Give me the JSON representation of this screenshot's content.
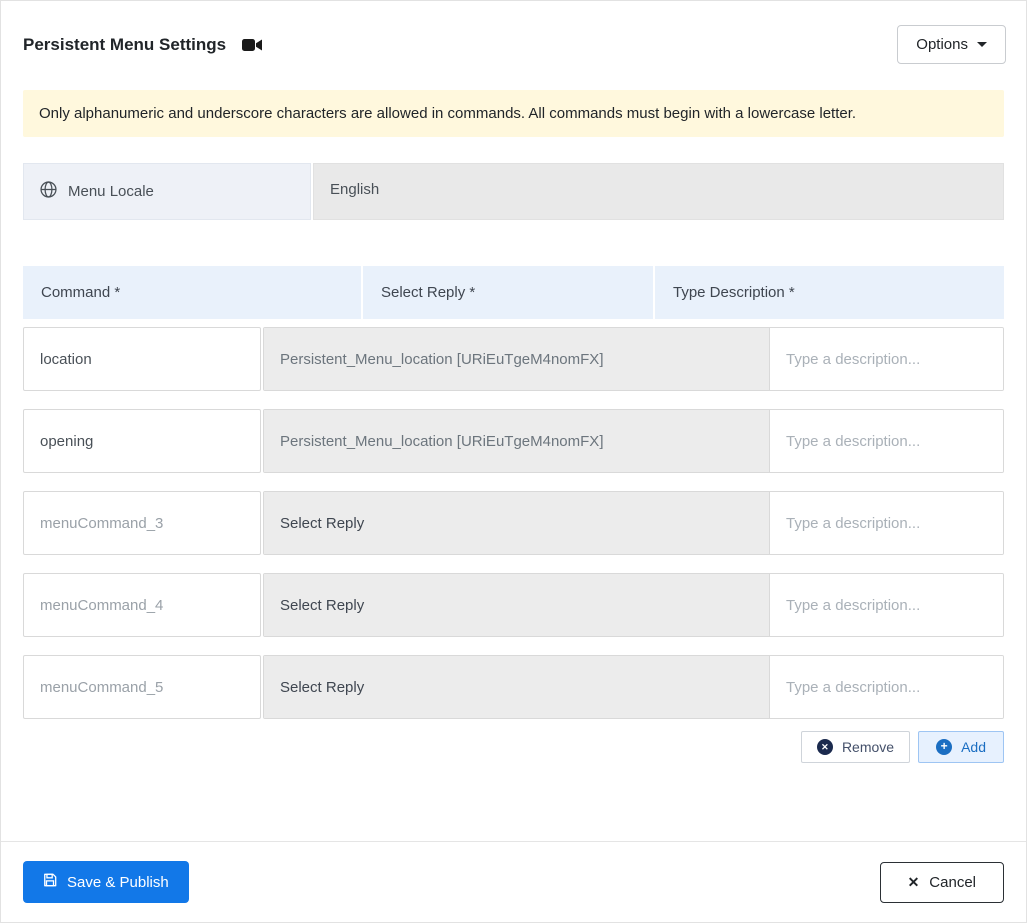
{
  "header": {
    "title": "Persistent Menu Settings",
    "options_label": "Options"
  },
  "alert": {
    "text": "Only alphanumeric and underscore characters are allowed in commands. All commands must begin with a lowercase letter."
  },
  "locale": {
    "label": "Menu Locale",
    "value": "English"
  },
  "table": {
    "headers": [
      "Command *",
      "Select Reply *",
      "Type Description *"
    ]
  },
  "rows": [
    {
      "command_value": "location",
      "reply": "Persistent_Menu_location [URiEuTgeM4nomFX]",
      "description_placeholder": "Type a description..."
    },
    {
      "command_value": "opening",
      "reply": "Persistent_Menu_location [URiEuTgeM4nomFX]",
      "description_placeholder": "Type a description..."
    },
    {
      "command_placeholder": "menuCommand_3",
      "reply": "Select Reply",
      "description_placeholder": "Type a description..."
    },
    {
      "command_placeholder": "menuCommand_4",
      "reply": "Select Reply",
      "description_placeholder": "Type a description..."
    },
    {
      "command_placeholder": "menuCommand_5",
      "reply": "Select Reply",
      "description_placeholder": "Type a description..."
    }
  ],
  "actions": {
    "remove_label": "Remove",
    "add_label": "Add"
  },
  "footer": {
    "save_label": "Save & Publish",
    "cancel_label": "Cancel"
  },
  "colors": {
    "primary_blue": "#1278e8",
    "alert_bg": "#fff8dd",
    "header_bg": "#e9f1fb"
  }
}
